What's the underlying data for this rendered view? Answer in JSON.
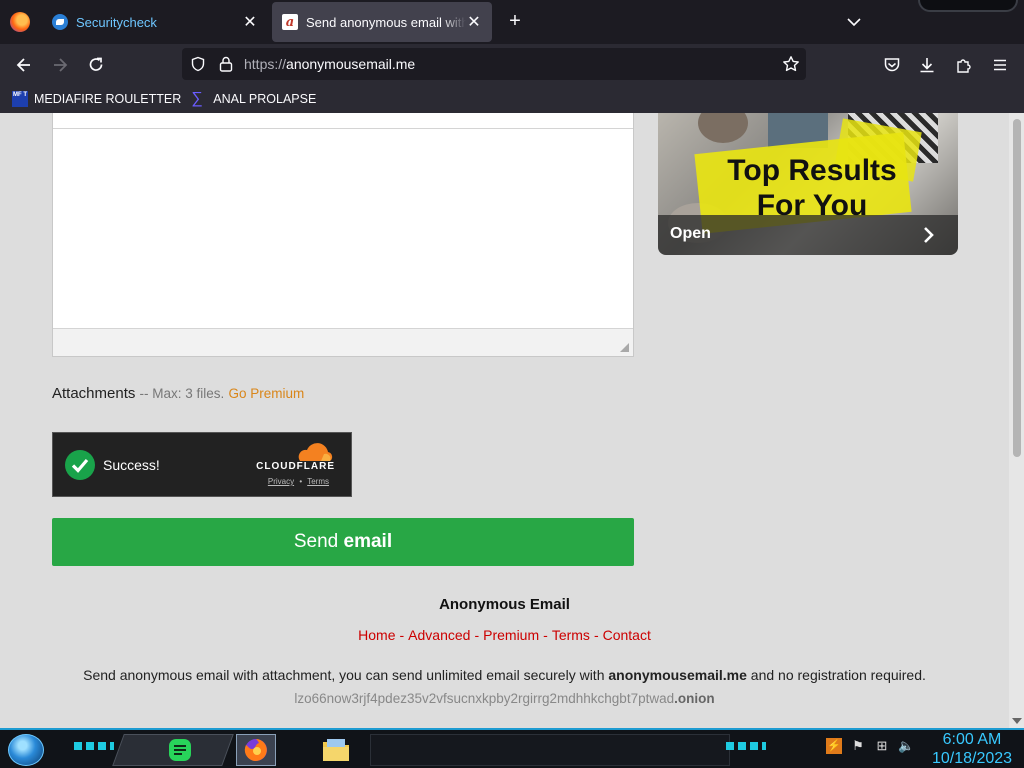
{
  "browser": {
    "tabs": [
      {
        "title": "Securitycheck",
        "active": false
      },
      {
        "title": "Send anonymous email with the",
        "active": true
      }
    ],
    "url_protocol": "https://",
    "url_host": "anonymousemail.me",
    "bookmarks": [
      {
        "label": "MEDIAFIRE ROULETTER",
        "icon": "mediafire-icon",
        "icon_text": "MF T"
      },
      {
        "label": "ANAL PROLAPSE",
        "icon": "sigma-icon",
        "icon_text": "∑"
      }
    ]
  },
  "ad": {
    "headline": "Top Results For You",
    "cta": "Open"
  },
  "form": {
    "attachments_label": "Attachments",
    "attachments_note": "-- Max: 3 files.",
    "premium_link": "Go Premium",
    "captcha": {
      "status": "Success!",
      "brand": "CLOUDFLARE",
      "privacy": "Privacy",
      "dot": "•",
      "terms": "Terms"
    },
    "send_prefix": "Send",
    "send_bold": "email"
  },
  "footer": {
    "title": "Anonymous Email",
    "nav": [
      "Home",
      "Advanced",
      "Premium",
      "Terms",
      "Contact"
    ],
    "separator": "-",
    "desc_prefix": "Send anonymous email with attachment, you can send unlimited email securely with",
    "desc_site": "anonymousemail.me",
    "desc_suffix": "and no registration required.",
    "onion_prefix": "lzo66now3rjf4pdez35v2vfsucnxkpby2rgirrg2mdhhkchgbt7ptwad",
    "onion_suffix": ".onion"
  },
  "taskbar": {
    "time": "6:00 AM",
    "date": "10/18/2023"
  },
  "colors": {
    "send_button": "#28a745",
    "footer_links": "#cc0000",
    "premium_link": "#d9861a",
    "clock": "#38c9ff"
  }
}
